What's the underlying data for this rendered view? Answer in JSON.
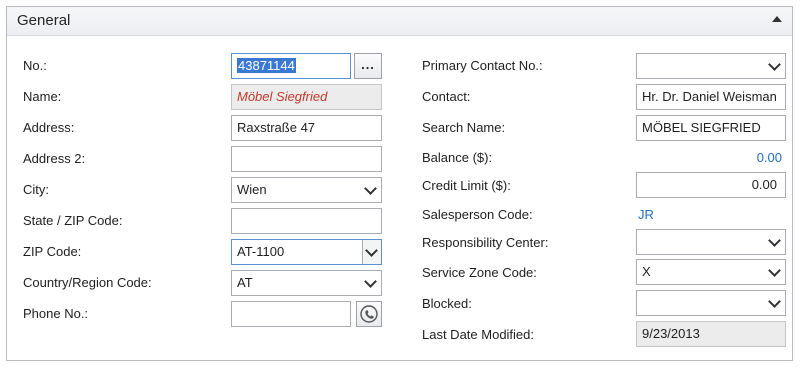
{
  "section": {
    "title": "General"
  },
  "left": {
    "no": {
      "label": "No.:",
      "value": "43871144"
    },
    "name": {
      "label": "Name:",
      "value": "Möbel Siegfried"
    },
    "address": {
      "label": "Address:",
      "value": "Raxstraße 47"
    },
    "address2": {
      "label": "Address 2:",
      "value": ""
    },
    "city": {
      "label": "City:",
      "value": "Wien"
    },
    "state_zip": {
      "label": "State / ZIP Code:",
      "value": ""
    },
    "zip": {
      "label": "ZIP Code:",
      "value": "AT-1100"
    },
    "country": {
      "label": "Country/Region Code:",
      "value": "AT"
    },
    "phone": {
      "label": "Phone No.:",
      "value": ""
    },
    "lookup_button": "..."
  },
  "right": {
    "primary_contact": {
      "label": "Primary Contact No.:",
      "value": ""
    },
    "contact": {
      "label": "Contact:",
      "value": "Hr. Dr. Daniel Weisman"
    },
    "search_name": {
      "label": "Search Name:",
      "value": "MÖBEL SIEGFRIED"
    },
    "balance": {
      "label": "Balance ($):",
      "value": "0.00"
    },
    "credit_limit": {
      "label": "Credit Limit ($):",
      "value": "0.00"
    },
    "salesperson": {
      "label": "Salesperson Code:",
      "value": "JR"
    },
    "responsibility": {
      "label": "Responsibility Center:",
      "value": ""
    },
    "service_zone": {
      "label": "Service Zone Code:",
      "value": "X"
    },
    "blocked": {
      "label": "Blocked:",
      "value": ""
    },
    "last_modified": {
      "label": "Last Date Modified:",
      "value": "9/23/2013"
    }
  },
  "colors": {
    "link_blue": "#1f6fc5",
    "name_red": "#c0392b",
    "selection": "#3a78d4"
  },
  "icons": {
    "collapse": "chevron-up-icon",
    "phone": "phone-icon",
    "dropdown": "chevron-down-icon"
  }
}
